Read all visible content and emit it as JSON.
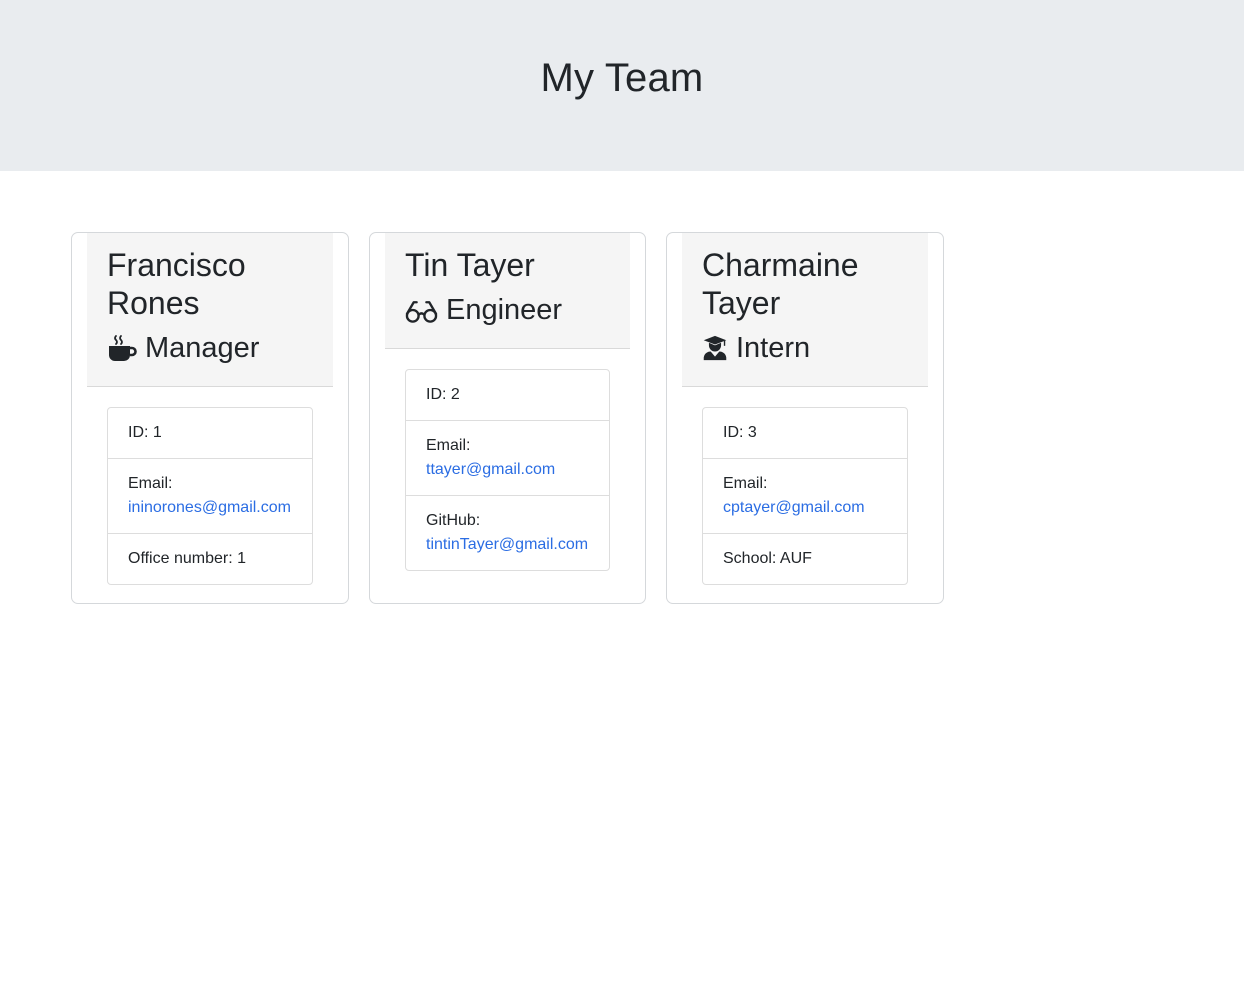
{
  "header": {
    "title": "My Team"
  },
  "cards": [
    {
      "name": "Francisco Rones",
      "role": "Manager",
      "role_icon": "coffee-mug-icon",
      "id_text": "ID: 1",
      "email_label": "Email:",
      "email": "ininorones@gmail.com",
      "extra_text": "Office number: 1"
    },
    {
      "name": "Tin Tayer",
      "role": "Engineer",
      "role_icon": "glasses-icon",
      "id_text": "ID: 2",
      "email_label": "Email:",
      "email": "ttayer@gmail.com",
      "github_label": "GitHub:",
      "github": "tintinTayer@gmail.com"
    },
    {
      "name": "Charmaine Tayer",
      "role": "Intern",
      "role_icon": "graduate-icon",
      "id_text": "ID: 3",
      "email_label": "Email:",
      "email": "cptayer@gmail.com",
      "extra_text": "School: AUF"
    }
  ],
  "colors": {
    "header_bg": "#e9ecef",
    "card_head_bg": "#f5f5f5",
    "link": "#2b6de3"
  }
}
